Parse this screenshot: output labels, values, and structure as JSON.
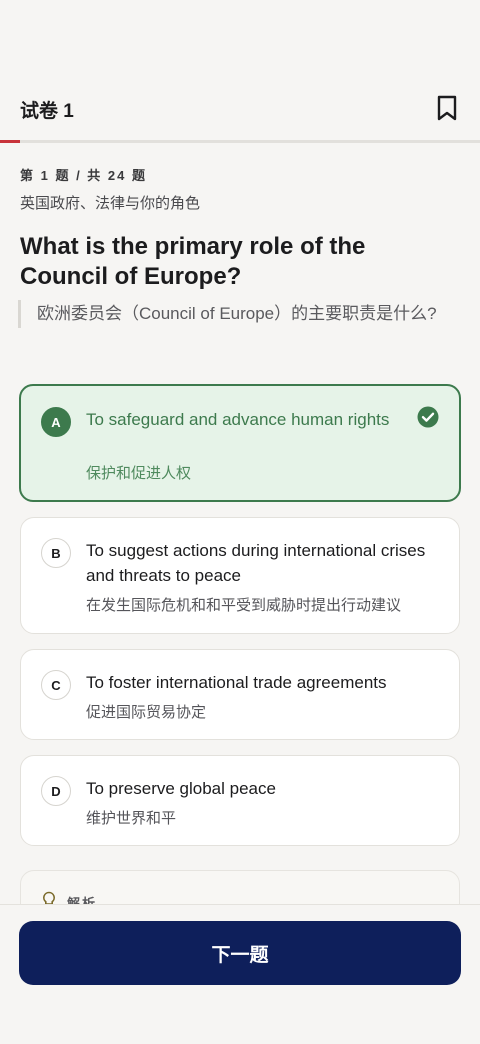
{
  "header": {
    "title": "试卷 1",
    "bookmark_icon": "bookmark-icon"
  },
  "progress": {
    "current": 1,
    "total": 24,
    "fraction": 0.0417,
    "color": "#c8333a"
  },
  "question": {
    "meta": "第 1 题 / 共 24 题",
    "category": "英国政府、法律与你的角色",
    "text": "What is the primary role of the Council of Europe?",
    "translation": "欧洲委员会（Council of Europe）的主要职责是什么?"
  },
  "options": [
    {
      "letter": "A",
      "en": "To safeguard and advance human rights",
      "zh": "保护和促进人权",
      "selected": true,
      "correct": true
    },
    {
      "letter": "B",
      "en": "To suggest actions during international crises and threats to peace",
      "zh": "在发生国际危机和和平受到威胁时提出行动建议",
      "selected": false
    },
    {
      "letter": "C",
      "en": "To foster international trade agreements",
      "zh": "促进国际贸易协定",
      "selected": false
    },
    {
      "letter": "D",
      "en": "To preserve global peace",
      "zh": "维护世界和平",
      "selected": false
    }
  ],
  "analysis": {
    "label": "解析",
    "icon": "lightbulb-icon"
  },
  "footer": {
    "next_label": "下一题"
  },
  "colors": {
    "correct": "#3d7a4d",
    "correct_bg": "#e6f3e8",
    "primary_button": "#0e1f5b",
    "accent": "#c8333a"
  }
}
